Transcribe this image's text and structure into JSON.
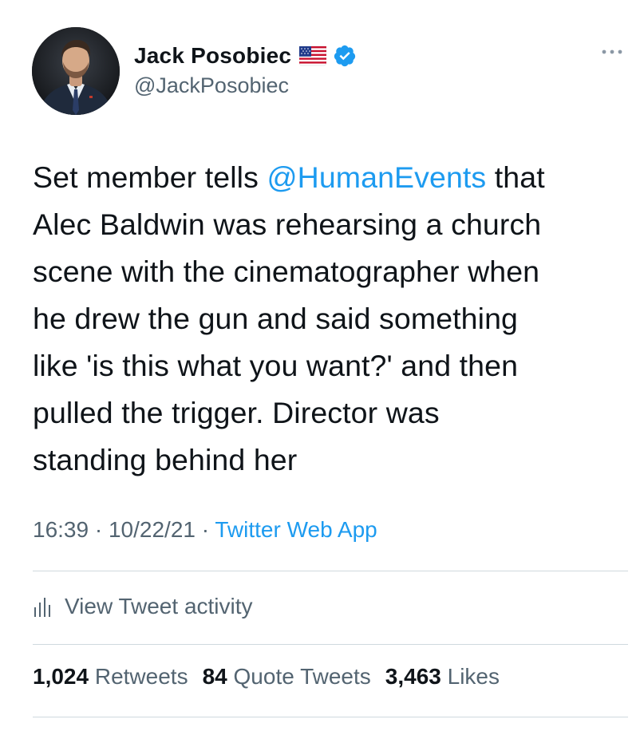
{
  "author": {
    "display_name": "Jack Posobiec",
    "handle": "@JackPosobiec",
    "flag_emoji": "us-flag-icon",
    "verified": true
  },
  "tweet": {
    "text_parts": [
      "Set member tells ",
      "@HumanEvents",
      " that\nAlec Baldwin was rehearsing a church\nscene with the cinematographer when\nhe drew the gun and said something\nlike 'is this what you want?' and then\npulled the trigger. Director was\nstanding behind her"
    ],
    "time": "16:39",
    "separator": " · ",
    "date": "10/22/21",
    "source": "Twitter Web App"
  },
  "activity": {
    "label": "View Tweet activity"
  },
  "stats": {
    "retweets_count": "1,024",
    "retweets_label": "Retweets",
    "quote_tweets_count": "84",
    "quote_tweets_label": "Quote Tweets",
    "likes_count": "3,463",
    "likes_label": "Likes"
  },
  "colors": {
    "link_blue": "#1d9bf0",
    "secondary_text": "#536471",
    "primary_text": "#0f1419",
    "divider": "#cfd9de"
  }
}
